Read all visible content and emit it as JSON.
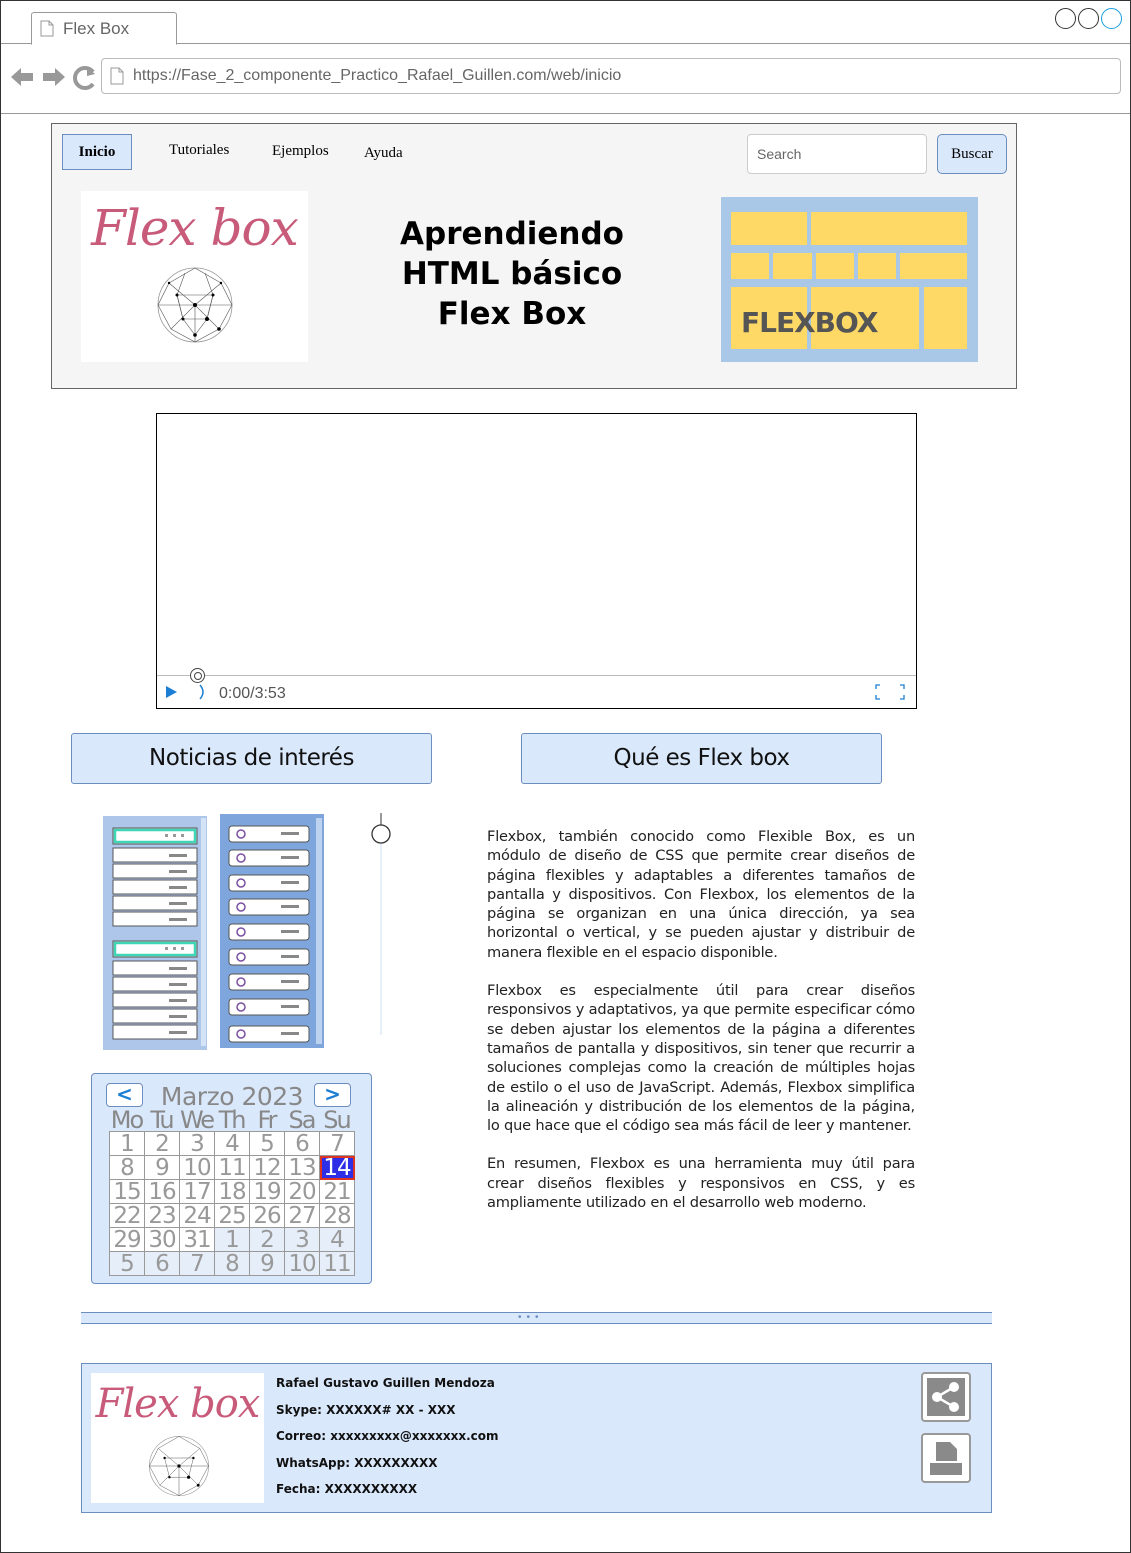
{
  "browser": {
    "tab_title": "Flex Box",
    "url": "https://Fase_2_componente_Practico_Rafael_Guillen.com/web/inicio"
  },
  "header": {
    "menu": {
      "active": "Inicio",
      "items": [
        "Tutoriales",
        "Ejemplos",
        "Ayuda"
      ]
    },
    "search": {
      "placeholder": "Search",
      "button": "Buscar"
    },
    "logo_text": "Flex box",
    "hero_lines": [
      "Aprendiendo",
      "HTML básico",
      "Flex Box"
    ],
    "graphic_label": "FLEXBOX"
  },
  "video": {
    "time": "0:00/3:53",
    "progress": 0.05
  },
  "sections": {
    "left_button": "Noticias de interés",
    "right_button": "Qué es Flex box"
  },
  "calendar": {
    "prev": "<",
    "next": ">",
    "title": "Marzo 2023",
    "weekdays": [
      "Mo",
      "Tu",
      "We",
      "Th",
      "Fr",
      "Sa",
      "Su"
    ],
    "days": [
      "1",
      "2",
      "3",
      "4",
      "5",
      "6",
      "7",
      "8",
      "9",
      "10",
      "11",
      "12",
      "13",
      "14",
      "15",
      "16",
      "17",
      "18",
      "19",
      "20",
      "21",
      "22",
      "23",
      "24",
      "25",
      "26",
      "27",
      "28",
      "29",
      "30",
      "31",
      "1",
      "2",
      "3",
      "4",
      "5",
      "6",
      "7",
      "8",
      "9",
      "10",
      "11"
    ],
    "selected": "14"
  },
  "article": {
    "paragraphs": [
      "Flexbox, también conocido como Flexible Box, es un módulo de diseño de CSS que permite crear diseños de página flexibles y adaptables a diferentes tamaños de pantalla y dispositivos. Con Flexbox, los elementos de la página se organizan en una única dirección, ya sea horizontal o vertical, y se pueden ajustar y distribuir de manera flexible en el espacio disponible.",
      "Flexbox es especialmente útil para crear diseños responsivos y adaptativos, ya que permite especificar cómo se deben ajustar los elementos de la página a diferentes tamaños de pantalla y dispositivos, sin tener que recurrir a soluciones complejas como la creación de múltiples hojas de estilo o el uso de JavaScript. Además, Flexbox simplifica la alineación y distribución de los elementos de la página, lo que hace que el código sea más fácil de leer y mantener.",
      "En resumen, Flexbox es una herramienta muy útil para crear diseños flexibles y responsivos en CSS, y es ampliamente utilizado en el desarrollo web moderno."
    ]
  },
  "footer": {
    "logo_text": "Flex box",
    "name": "Rafael Gustavo Guillen Mendoza",
    "skype": "Skype: XXXXXX# XX - XXX",
    "correo": "Correo: xxxxxxxxx@xxxxxxx.com",
    "whatsapp": "WhatsApp: XXXXXXXXX",
    "fecha": "Fecha: XXXXXXXXXX",
    "icons": [
      "share-icon",
      "print-icon"
    ]
  },
  "colors": {
    "accent_blue": "#dae8fc",
    "border_blue": "#6c8ebf",
    "logo_pink": "#c85a7a",
    "flexbox_yellow": "#ffd966",
    "today": "#2e2ee6"
  }
}
